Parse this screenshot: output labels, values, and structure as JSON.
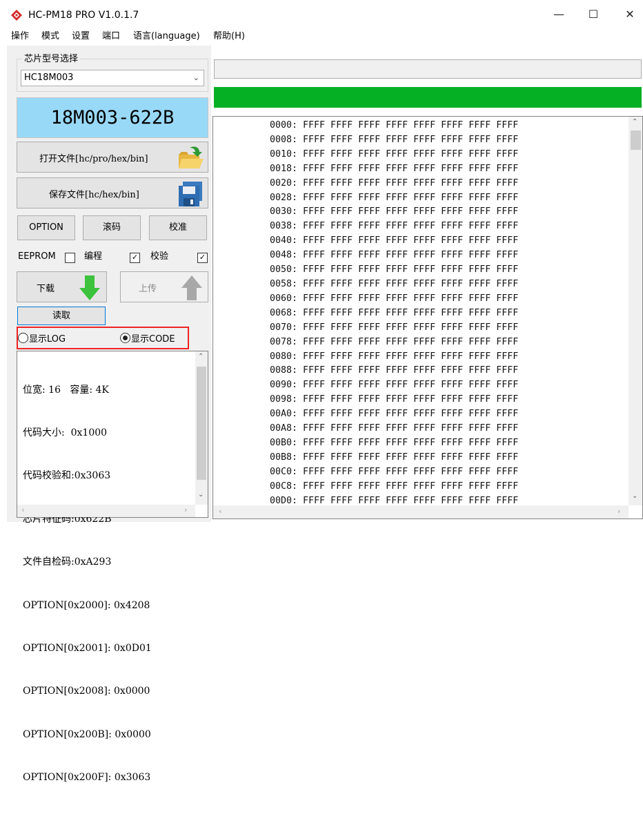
{
  "window": {
    "title": "HC-PM18 PRO V1.0.1.7",
    "minimize_glyph": "—",
    "maximize_glyph": "☐",
    "close_glyph": "✕"
  },
  "menu": [
    "操作",
    "模式",
    "设置",
    "端口",
    "语言(language)",
    "帮助(H)"
  ],
  "chip_select": {
    "group_label": "芯片型号选择",
    "value": "HC18M003"
  },
  "chip_display": "18M003-622B",
  "buttons": {
    "open_file": "打开文件[hc/pro/hex/bin]",
    "save_file": "保存文件[hc/hex/bin]",
    "option": "OPTION",
    "rolling_code": "滚码",
    "calibrate": "校准",
    "download": "下载",
    "upload": "上传",
    "read": "读取"
  },
  "checkboxes": [
    {
      "label": "EEPROM",
      "checked": false
    },
    {
      "label": "编程",
      "checked": true
    },
    {
      "label": "校验",
      "checked": true
    }
  ],
  "display_mode": {
    "log_label": "显示LOG",
    "code_label": "显示CODE",
    "selected": "code"
  },
  "log": [
    "位宽: 16   容量: 4K",
    "代码大小:  0x1000",
    "代码校验和:0x3063",
    "芯片特征码:0x622B",
    "文件自检码:0xA293",
    "OPTION[0x2000]: 0x4208",
    "OPTION[0x2001]: 0x0D01",
    "OPTION[0x2008]: 0x0000",
    "OPTION[0x200B]: 0x0000",
    "OPTION[0x200F]: 0x3063"
  ],
  "progress": 1.0,
  "colors": {
    "progress_fill": "#06b025",
    "chip_display_bg": "#99d9f8",
    "highlight_frame": "#e22222"
  },
  "code_rows": [
    "0000: FFFF FFFF FFFF FFFF FFFF FFFF FFFF FFFF",
    "0008: FFFF FFFF FFFF FFFF FFFF FFFF FFFF FFFF",
    "0010: FFFF FFFF FFFF FFFF FFFF FFFF FFFF FFFF",
    "0018: FFFF FFFF FFFF FFFF FFFF FFFF FFFF FFFF",
    "0020: FFFF FFFF FFFF FFFF FFFF FFFF FFFF FFFF",
    "0028: FFFF FFFF FFFF FFFF FFFF FFFF FFFF FFFF",
    "0030: FFFF FFFF FFFF FFFF FFFF FFFF FFFF FFFF",
    "0038: FFFF FFFF FFFF FFFF FFFF FFFF FFFF FFFF",
    "0040: FFFF FFFF FFFF FFFF FFFF FFFF FFFF FFFF",
    "0048: FFFF FFFF FFFF FFFF FFFF FFFF FFFF FFFF",
    "0050: FFFF FFFF FFFF FFFF FFFF FFFF FFFF FFFF",
    "0058: FFFF FFFF FFFF FFFF FFFF FFFF FFFF FFFF",
    "0060: FFFF FFFF FFFF FFFF FFFF FFFF FFFF FFFF",
    "0068: FFFF FFFF FFFF FFFF FFFF FFFF FFFF FFFF",
    "0070: FFFF FFFF FFFF FFFF FFFF FFFF FFFF FFFF",
    "0078: FFFF FFFF FFFF FFFF FFFF FFFF FFFF FFFF",
    "0080: FFFF FFFF FFFF FFFF FFFF FFFF FFFF FFFF",
    "0088: FFFF FFFF FFFF FFFF FFFF FFFF FFFF FFFF",
    "0090: FFFF FFFF FFFF FFFF FFFF FFFF FFFF FFFF",
    "0098: FFFF FFFF FFFF FFFF FFFF FFFF FFFF FFFF",
    "00A0: FFFF FFFF FFFF FFFF FFFF FFFF FFFF FFFF",
    "00A8: FFFF FFFF FFFF FFFF FFFF FFFF FFFF FFFF",
    "00B0: FFFF FFFF FFFF FFFF FFFF FFFF FFFF FFFF",
    "00B8: FFFF FFFF FFFF FFFF FFFF FFFF FFFF FFFF",
    "00C0: FFFF FFFF FFFF FFFF FFFF FFFF FFFF FFFF",
    "00C8: FFFF FFFF FFFF FFFF FFFF FFFF FFFF FFFF",
    "00D0: FFFF FFFF FFFF FFFF FFFF FFFF FFFF FFFF"
  ]
}
